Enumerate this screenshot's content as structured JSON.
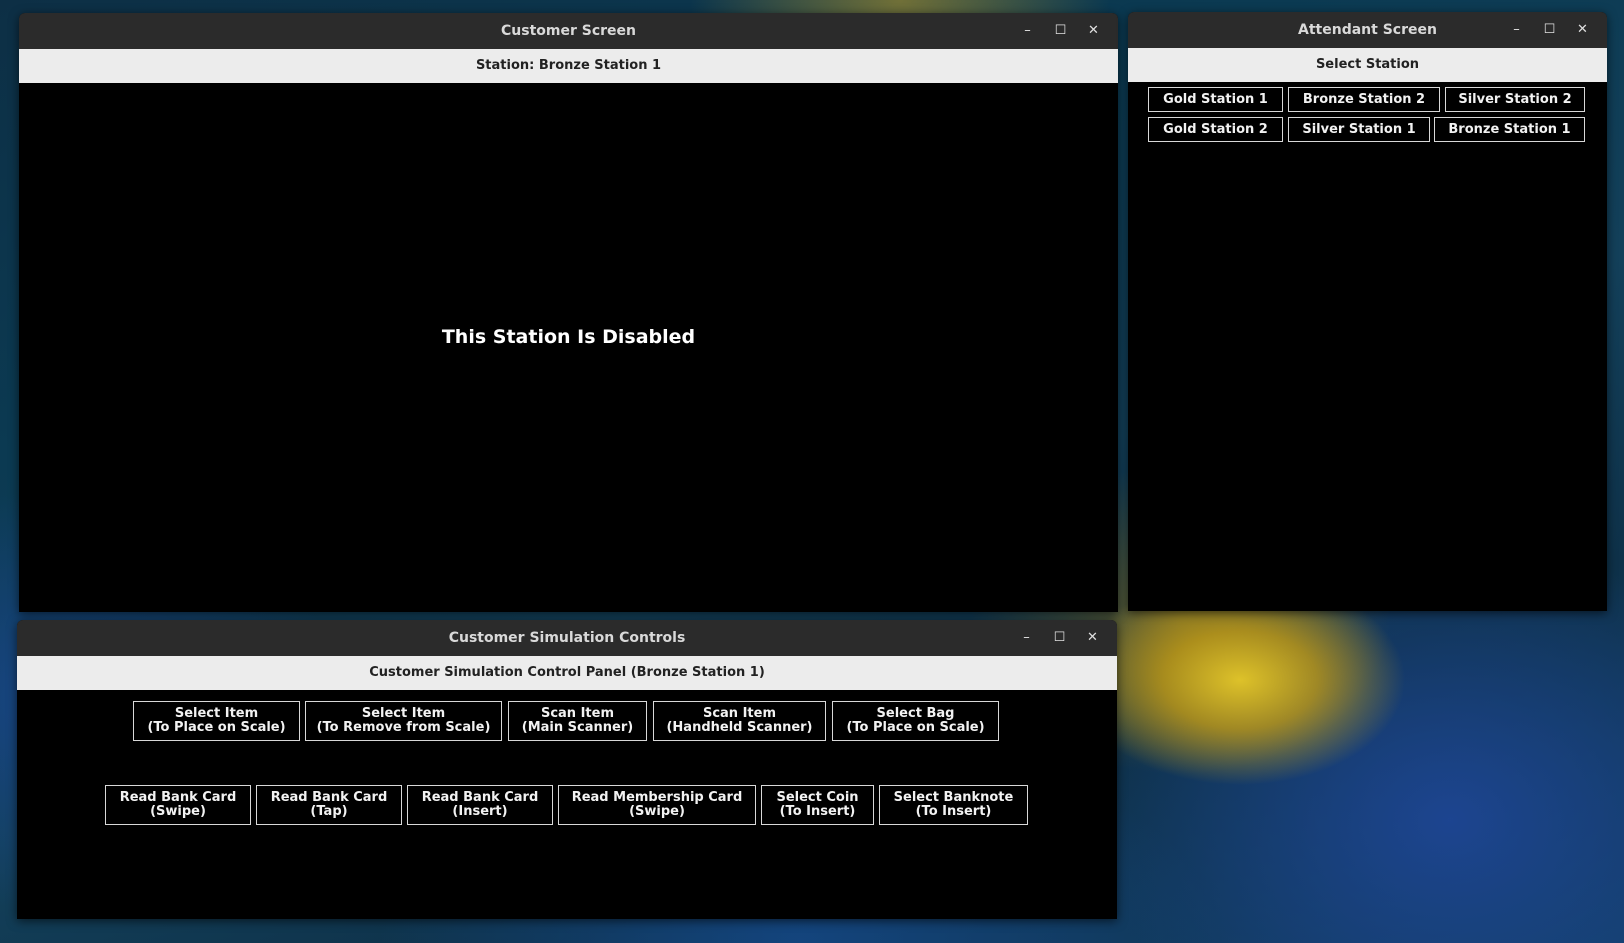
{
  "customer_window": {
    "title": "Customer Screen",
    "station_header": "Station: Bronze Station 1",
    "message": "This Station Is Disabled"
  },
  "attendant_window": {
    "title": "Attendant Screen",
    "header": "Select Station",
    "stations": [
      "Gold Station 1",
      "Bronze Station 2",
      "Silver Station 2",
      "Gold Station 2",
      "Silver Station 1",
      "Bronze Station 1"
    ]
  },
  "controls_window": {
    "title": "Customer Simulation Controls",
    "header": "Customer Simulation Control Panel (Bronze Station 1)",
    "row1": [
      {
        "line1": "Select Item",
        "line2": "(To Place on Scale)"
      },
      {
        "line1": "Select Item",
        "line2": "(To Remove from Scale)"
      },
      {
        "line1": "Scan Item",
        "line2": "(Main Scanner)"
      },
      {
        "line1": "Scan Item",
        "line2": "(Handheld Scanner)"
      },
      {
        "line1": "Select Bag",
        "line2": "(To Place on Scale)"
      }
    ],
    "row2": [
      {
        "line1": "Read Bank Card",
        "line2": "(Swipe)"
      },
      {
        "line1": "Read Bank Card",
        "line2": "(Tap)"
      },
      {
        "line1": "Read Bank Card",
        "line2": "(Insert)"
      },
      {
        "line1": "Read Membership Card",
        "line2": "(Swipe)"
      },
      {
        "line1": "Select Coin",
        "line2": "(To Insert)"
      },
      {
        "line1": "Select Banknote",
        "line2": "(To Insert)"
      }
    ]
  },
  "window_buttons": {
    "minimize": "–",
    "maximize": "☐",
    "close": "✕"
  }
}
